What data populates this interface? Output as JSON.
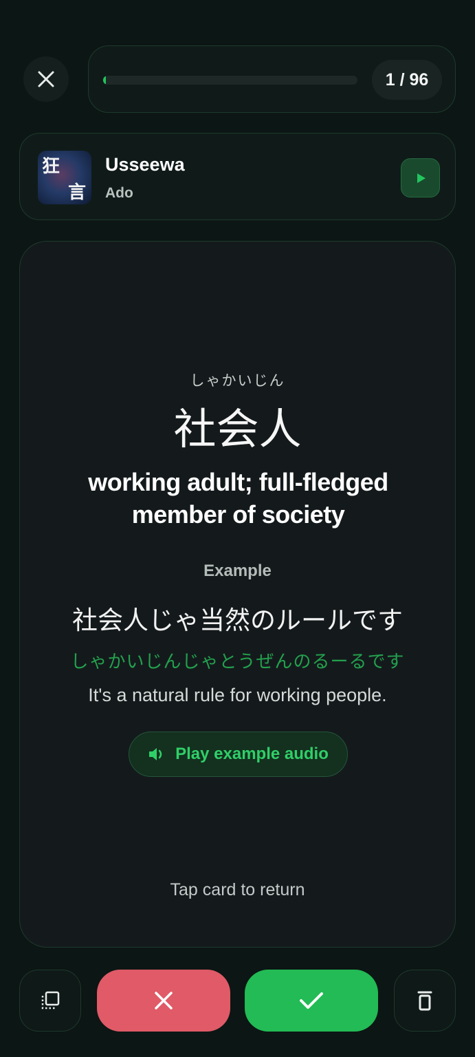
{
  "header": {
    "close_icon": "close-icon",
    "progress": {
      "current": 1,
      "total": 96,
      "fraction": 0.0104,
      "counter_text": "1 / 96"
    }
  },
  "song": {
    "title": "Usseewa",
    "artist": "Ado",
    "album_art_text": "狂言",
    "play_icon": "play-icon"
  },
  "card": {
    "reading": "しゃかいじん",
    "word": "社会人",
    "meaning": "working adult; full-fledged member of society",
    "example_label": "Example",
    "example_jp": "社会人じゃ当然のルールです",
    "example_kana": "しゃかいじんじゃとうぜんのるーるです",
    "example_en": "It's a natural rule for working people.",
    "play_example_label": "Play example audio",
    "tap_hint": "Tap card to return"
  },
  "actions": {
    "left_icon": "card-stack-icon",
    "wrong_icon": "x-icon",
    "right_icon": "check-icon",
    "delete_icon": "trash-icon"
  },
  "colors": {
    "accent": "#22c55e",
    "wrong": "#e05a67",
    "right": "#22bb55",
    "background": "#0c1614"
  }
}
